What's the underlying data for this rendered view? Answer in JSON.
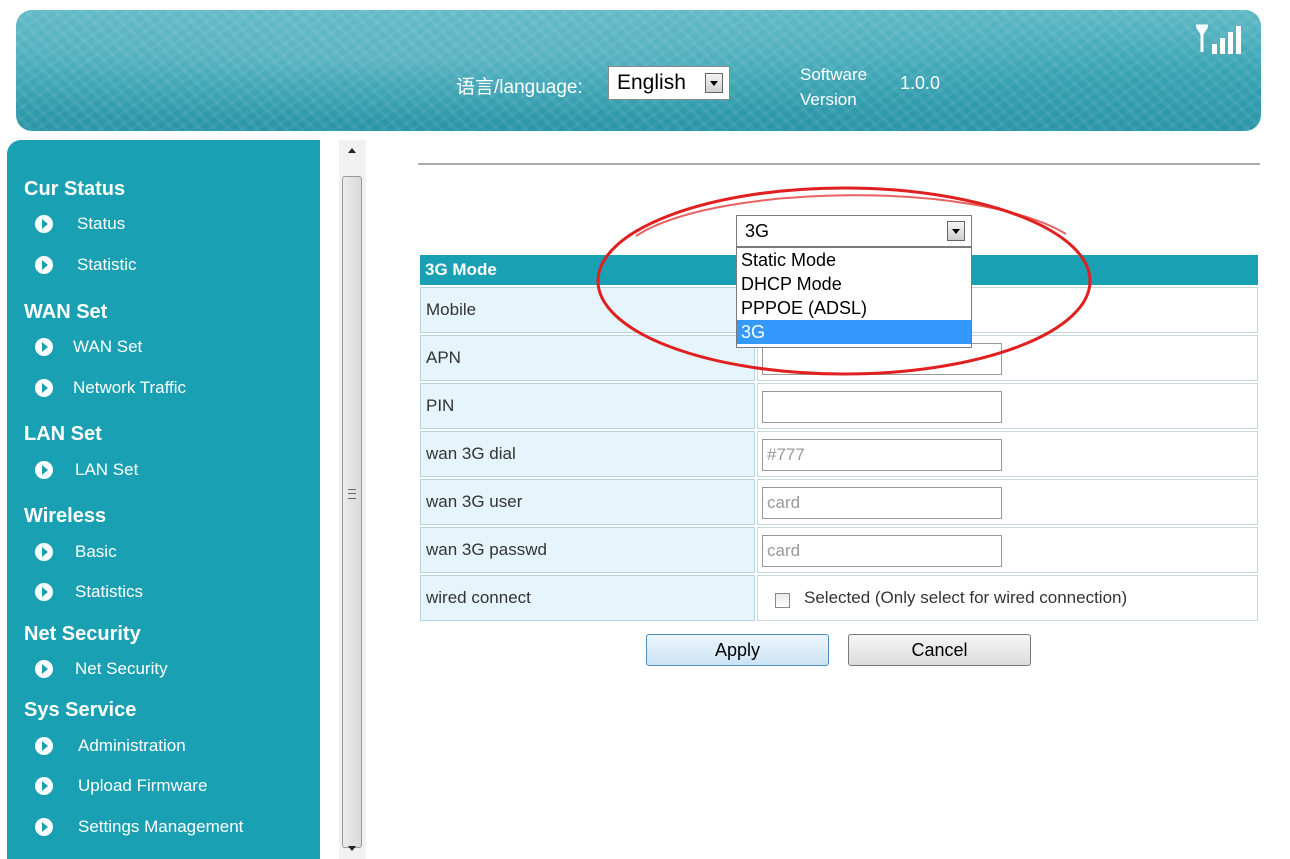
{
  "header": {
    "language_label": "语言/language:",
    "language_selected": "English",
    "software_label": "Software Version",
    "software_version": "1.0.0",
    "signal_icon": "signal-strength-icon"
  },
  "sidebar": {
    "groups": [
      {
        "title": "Cur Status",
        "items": [
          "Status",
          "Statistic"
        ]
      },
      {
        "title": "WAN Set",
        "items": [
          "WAN Set",
          "Network Traffic"
        ]
      },
      {
        "title": "LAN Set",
        "items": [
          "LAN Set"
        ]
      },
      {
        "title": "Wireless",
        "items": [
          "Basic",
          "Statistics"
        ]
      },
      {
        "title": "Net Security",
        "items": [
          "Net Security"
        ]
      },
      {
        "title": "Sys Service",
        "items": [
          "Administration",
          "Upload Firmware",
          "Settings Management"
        ]
      }
    ]
  },
  "mode": {
    "selected": "3G",
    "options": [
      "Static Mode",
      "DHCP Mode",
      "PPPOE (ADSL)",
      "3G"
    ]
  },
  "form": {
    "header": "3G Mode",
    "rows": [
      {
        "label": "Mobile",
        "value": ""
      },
      {
        "label": "APN",
        "value": ""
      },
      {
        "label": "PIN",
        "value": ""
      },
      {
        "label": "wan 3G dial",
        "value": "#777"
      },
      {
        "label": "wan 3G user",
        "value": "card"
      },
      {
        "label": "wan 3G passwd",
        "value": "card"
      },
      {
        "label": "wired connect",
        "value": ""
      }
    ],
    "wired_checkbox_label": "Selected (Only select for wired connection)"
  },
  "buttons": {
    "apply": "Apply",
    "cancel": "Cancel"
  },
  "colors": {
    "accent": "#1aa0b3",
    "highlight": "#3399ff",
    "annotation": "#e02020"
  }
}
